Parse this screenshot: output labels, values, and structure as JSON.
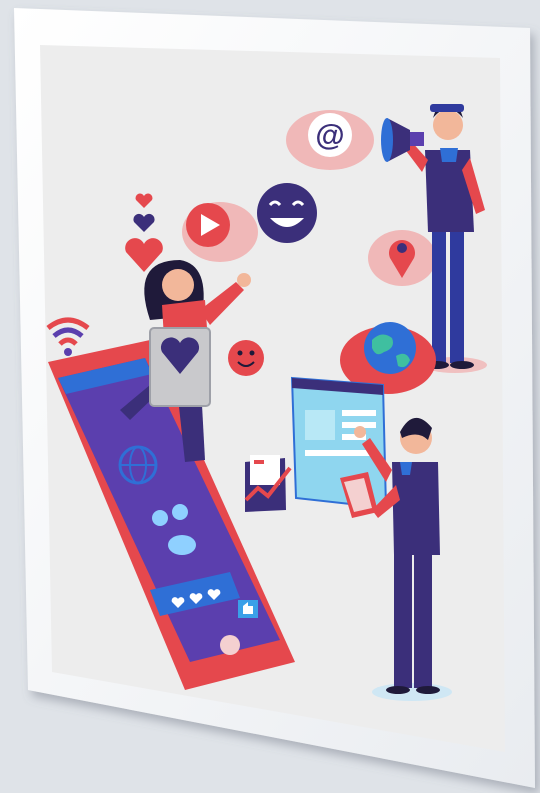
{
  "image": {
    "subject": "social-media-marketing-illustration",
    "colors": {
      "background": "#dfe3e8",
      "frame": "#ffffff",
      "canvas": "#eeeeee",
      "red": "#e5484d",
      "navy": "#3b2f7a",
      "purple": "#5b3fae",
      "blue": "#2f6fd6",
      "cloud": "#f0b8b8",
      "skin": "#f2b79a",
      "hair": "#1f1a3a"
    },
    "icons": [
      "at-sign-icon",
      "play-icon",
      "smiley-icon",
      "location-pin-icon",
      "globe-icon",
      "heart-icon",
      "megaphone-icon",
      "wifi-icon",
      "like-icon"
    ]
  }
}
